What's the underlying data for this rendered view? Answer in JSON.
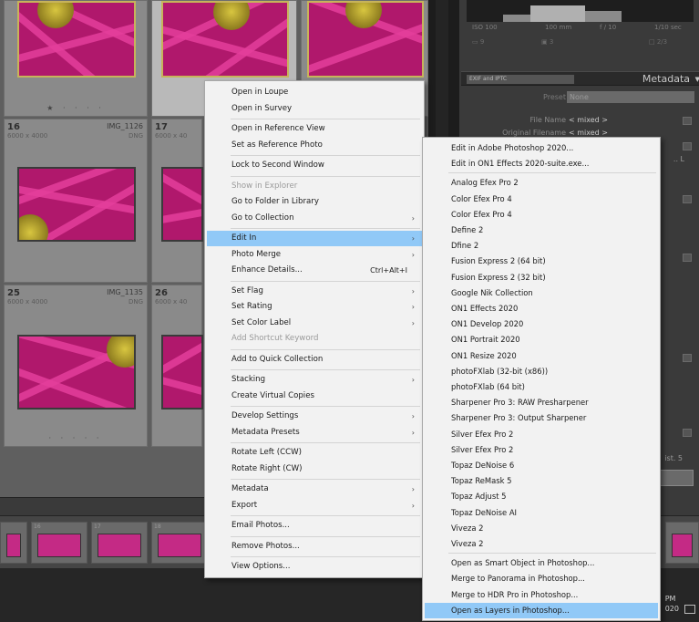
{
  "grid": {
    "top_row": [
      {
        "selected": false
      },
      {
        "selected": true
      },
      {
        "selected": false
      }
    ],
    "rows": [
      {
        "cells": [
          {
            "num": "16",
            "dim": "6000 x 4000",
            "fname": "IMG_1126",
            "ftype": "DNG"
          },
          {
            "num": "17",
            "dim": "6000 x 40",
            "fname": "",
            "ftype": ""
          }
        ]
      },
      {
        "cells": [
          {
            "num": "25",
            "dim": "6000 x 4000",
            "fname": "IMG_1135",
            "ftype": "DNG"
          },
          {
            "num": "26",
            "dim": "6000 x 40",
            "fname": "",
            "ftype": ""
          }
        ]
      }
    ],
    "rating_glyph": "★ · · · ·"
  },
  "filmstrip": {
    "cells": [
      "",
      "16",
      "17",
      "18",
      ""
    ]
  },
  "taskbar": {
    "clock_line1": "PM",
    "clock_line2": "020"
  },
  "right_panel": {
    "exif": {
      "iso": "ISO 100",
      "focal": "100 mm",
      "aperture": "f / 10",
      "shutter": "1/10 sec"
    },
    "hist_tools": {
      "left": "▭ 9",
      "mid": "▣ 3",
      "right": "□ 2/3"
    },
    "metadata_panel": {
      "selector": "EXIF and IPTC",
      "title": "Metadata",
      "toggle": "▼",
      "preset_label": "Preset",
      "preset_value": "None",
      "rows": [
        {
          "label": "File Name",
          "value": "< mixed >"
        },
        {
          "label": "Original Filename",
          "value": "< mixed >"
        }
      ],
      "side_values": [
        ".. L",
        "ist. 5"
      ]
    }
  },
  "context_menu": {
    "items": [
      {
        "label": "Open in Loupe",
        "shortcut": "",
        "submenu": false,
        "disabled": false,
        "highlight": false,
        "sep_after": false
      },
      {
        "label": "Open in Survey",
        "shortcut": "",
        "submenu": false,
        "disabled": false,
        "highlight": false,
        "sep_after": true
      },
      {
        "label": "Open in Reference View",
        "shortcut": "",
        "submenu": false,
        "disabled": false,
        "highlight": false,
        "sep_after": false
      },
      {
        "label": "Set as Reference Photo",
        "shortcut": "",
        "submenu": false,
        "disabled": false,
        "highlight": false,
        "sep_after": true
      },
      {
        "label": "Lock to Second Window",
        "shortcut": "",
        "submenu": false,
        "disabled": false,
        "highlight": false,
        "sep_after": true
      },
      {
        "label": "Show in Explorer",
        "shortcut": "",
        "submenu": false,
        "disabled": true,
        "highlight": false,
        "sep_after": false
      },
      {
        "label": "Go to Folder in Library",
        "shortcut": "",
        "submenu": false,
        "disabled": false,
        "highlight": false,
        "sep_after": false
      },
      {
        "label": "Go to Collection",
        "shortcut": "",
        "submenu": true,
        "disabled": false,
        "highlight": false,
        "sep_after": true
      },
      {
        "label": "Edit In",
        "shortcut": "",
        "submenu": true,
        "disabled": false,
        "highlight": true,
        "sep_after": false
      },
      {
        "label": "Photo Merge",
        "shortcut": "",
        "submenu": true,
        "disabled": false,
        "highlight": false,
        "sep_after": false
      },
      {
        "label": "Enhance Details...",
        "shortcut": "Ctrl+Alt+I",
        "submenu": false,
        "disabled": false,
        "highlight": false,
        "sep_after": true
      },
      {
        "label": "Set Flag",
        "shortcut": "",
        "submenu": true,
        "disabled": false,
        "highlight": false,
        "sep_after": false
      },
      {
        "label": "Set Rating",
        "shortcut": "",
        "submenu": true,
        "disabled": false,
        "highlight": false,
        "sep_after": false
      },
      {
        "label": "Set Color Label",
        "shortcut": "",
        "submenu": true,
        "disabled": false,
        "highlight": false,
        "sep_after": false
      },
      {
        "label": "Add Shortcut Keyword",
        "shortcut": "",
        "submenu": false,
        "disabled": true,
        "highlight": false,
        "sep_after": true
      },
      {
        "label": "Add to Quick Collection",
        "shortcut": "",
        "submenu": false,
        "disabled": false,
        "highlight": false,
        "sep_after": true
      },
      {
        "label": "Stacking",
        "shortcut": "",
        "submenu": true,
        "disabled": false,
        "highlight": false,
        "sep_after": false
      },
      {
        "label": "Create Virtual Copies",
        "shortcut": "",
        "submenu": false,
        "disabled": false,
        "highlight": false,
        "sep_after": true
      },
      {
        "label": "Develop Settings",
        "shortcut": "",
        "submenu": true,
        "disabled": false,
        "highlight": false,
        "sep_after": false
      },
      {
        "label": "Metadata Presets",
        "shortcut": "",
        "submenu": true,
        "disabled": false,
        "highlight": false,
        "sep_after": true
      },
      {
        "label": "Rotate Left (CCW)",
        "shortcut": "",
        "submenu": false,
        "disabled": false,
        "highlight": false,
        "sep_after": false
      },
      {
        "label": "Rotate Right (CW)",
        "shortcut": "",
        "submenu": false,
        "disabled": false,
        "highlight": false,
        "sep_after": true
      },
      {
        "label": "Metadata",
        "shortcut": "",
        "submenu": true,
        "disabled": false,
        "highlight": false,
        "sep_after": false
      },
      {
        "label": "Export",
        "shortcut": "",
        "submenu": true,
        "disabled": false,
        "highlight": false,
        "sep_after": true
      },
      {
        "label": "Email Photos...",
        "shortcut": "",
        "submenu": false,
        "disabled": false,
        "highlight": false,
        "sep_after": true
      },
      {
        "label": "Remove Photos...",
        "shortcut": "",
        "submenu": false,
        "disabled": false,
        "highlight": false,
        "sep_after": true
      },
      {
        "label": "View Options...",
        "shortcut": "",
        "submenu": false,
        "disabled": false,
        "highlight": false,
        "sep_after": false
      }
    ]
  },
  "edit_in_submenu": {
    "items": [
      {
        "label": "Edit in Adobe Photoshop 2020...",
        "highlight": false,
        "sep_after": false
      },
      {
        "label": "Edit in ON1 Effects 2020-suite.exe...",
        "highlight": false,
        "sep_after": true
      },
      {
        "label": "Analog Efex Pro 2",
        "highlight": false,
        "sep_after": false
      },
      {
        "label": "Color Efex Pro 4",
        "highlight": false,
        "sep_after": false
      },
      {
        "label": "Color Efex Pro 4",
        "highlight": false,
        "sep_after": false
      },
      {
        "label": "Define 2",
        "highlight": false,
        "sep_after": false
      },
      {
        "label": "Dfine 2",
        "highlight": false,
        "sep_after": false
      },
      {
        "label": "Fusion Express 2 (64 bit)",
        "highlight": false,
        "sep_after": false
      },
      {
        "label": "Fusion Express 2 (32 bit)",
        "highlight": false,
        "sep_after": false
      },
      {
        "label": "Google Nik Collection",
        "highlight": false,
        "sep_after": false
      },
      {
        "label": "ON1 Effects 2020",
        "highlight": false,
        "sep_after": false
      },
      {
        "label": "ON1 Develop 2020",
        "highlight": false,
        "sep_after": false
      },
      {
        "label": "ON1 Portrait 2020",
        "highlight": false,
        "sep_after": false
      },
      {
        "label": "ON1 Resize 2020",
        "highlight": false,
        "sep_after": false
      },
      {
        "label": "photoFXlab (32-bit (x86))",
        "highlight": false,
        "sep_after": false
      },
      {
        "label": "photoFXlab (64 bit)",
        "highlight": false,
        "sep_after": false
      },
      {
        "label": "Sharpener Pro 3: RAW Presharpener",
        "highlight": false,
        "sep_after": false
      },
      {
        "label": "Sharpener Pro 3: Output Sharpener",
        "highlight": false,
        "sep_after": false
      },
      {
        "label": "Silver Efex Pro 2",
        "highlight": false,
        "sep_after": false
      },
      {
        "label": "Silver Efex Pro 2",
        "highlight": false,
        "sep_after": false
      },
      {
        "label": "Topaz DeNoise 6",
        "highlight": false,
        "sep_after": false
      },
      {
        "label": "Topaz ReMask 5",
        "highlight": false,
        "sep_after": false
      },
      {
        "label": "Topaz Adjust 5",
        "highlight": false,
        "sep_after": false
      },
      {
        "label": "Topaz DeNoise AI",
        "highlight": false,
        "sep_after": false
      },
      {
        "label": "Viveza 2",
        "highlight": false,
        "sep_after": false
      },
      {
        "label": "Viveza 2",
        "highlight": false,
        "sep_after": true
      },
      {
        "label": "Open as Smart Object in Photoshop...",
        "highlight": false,
        "sep_after": false
      },
      {
        "label": "Merge to Panorama in Photoshop...",
        "highlight": false,
        "sep_after": false
      },
      {
        "label": "Merge to HDR Pro in Photoshop...",
        "highlight": false,
        "sep_after": false
      },
      {
        "label": "Open as Layers in Photoshop...",
        "highlight": true,
        "sep_after": false
      }
    ]
  },
  "colors": {
    "menu_bg": "#f2f2f2",
    "highlight": "#91c9f7",
    "thumb_pink": "#c42a85"
  }
}
